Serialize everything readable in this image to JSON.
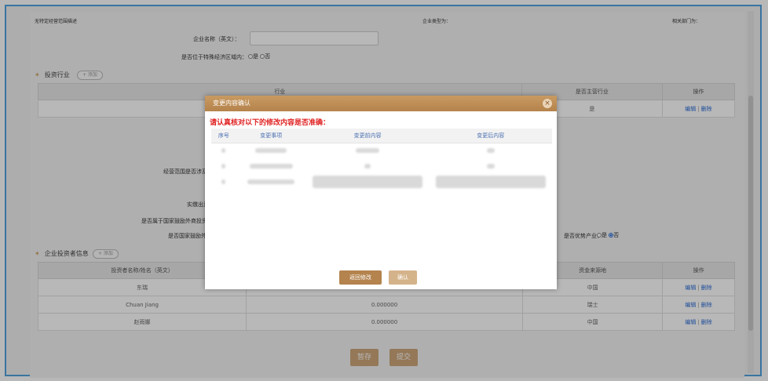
{
  "top_row": {
    "scope_desc": "无特定经营范围描述",
    "enterprise_type": "企业类型为：",
    "dept": "相关部门为："
  },
  "form": {
    "name_en_label": "企业名称（英文）：",
    "special_zone_label": "是否位于特殊经济区域内：",
    "yes": "是",
    "no": "否"
  },
  "invest_industry": {
    "title": "投资行业",
    "add_label": "+ 添加",
    "headers": [
      "行业",
      "是否主营行业",
      "操作"
    ],
    "row": {
      "main": "是",
      "edit": "编辑",
      "delete": "删除"
    }
  },
  "middle_labels": {
    "scope_involves": "经营范围是否涉及",
    "capital": "实缴出资额",
    "belongs": "是否属于国家鼓励外商投资产",
    "is_encouraged": "是否国家鼓励外商",
    "advantage": "是否优势产业：",
    "yes": "是",
    "no": "否"
  },
  "investors": {
    "title": "企业投资者信息",
    "add_label": "+ 添加",
    "headers": [
      "投资者名称/姓名（英文）",
      "资金来源地",
      "操作"
    ],
    "rows": [
      {
        "name": "东瑞",
        "amount": "",
        "origin": "中国",
        "edit": "编辑",
        "delete": "删除"
      },
      {
        "name": "Chuan Jiang",
        "amount": "0.000000",
        "origin": "瑞士",
        "edit": "编辑",
        "delete": "删除"
      },
      {
        "name": "赵雨娜",
        "amount": "0.000000",
        "origin": "中国",
        "edit": "编辑",
        "delete": "删除"
      }
    ]
  },
  "bottom_buttons": {
    "save": "暂存",
    "submit": "提交"
  },
  "modal": {
    "title": "变更内容确认",
    "close": "×",
    "warning": "请认真核对以下的修改内容是否准确：",
    "headers": [
      "序号",
      "变更事项",
      "变更前内容",
      "变更后内容"
    ],
    "back": "返回修改",
    "confirm": "确认"
  },
  "colors": {
    "accent": "#c99b5a",
    "warning": "#e02020",
    "link": "#2b6cd6",
    "frame": "#4fa3e0"
  }
}
